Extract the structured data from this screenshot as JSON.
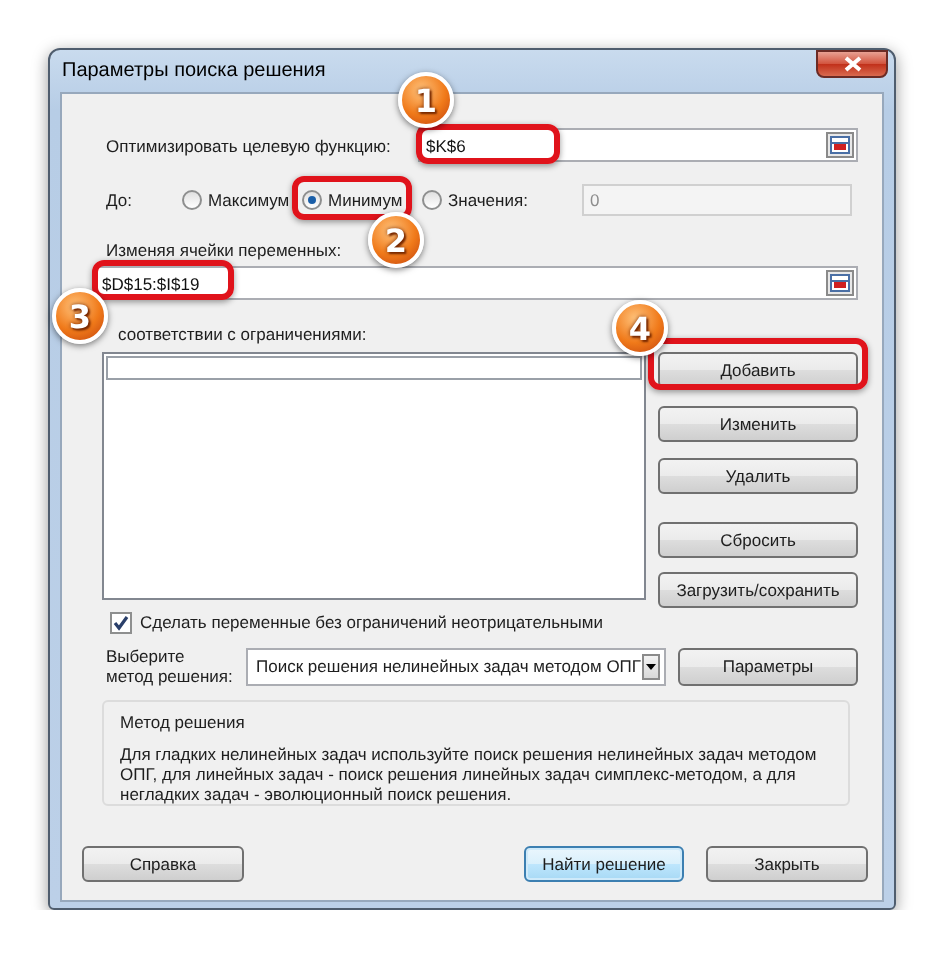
{
  "window": {
    "title": "Параметры поиска решения"
  },
  "objective": {
    "label": "Оптимизировать целевую функцию:",
    "value": "$K$6"
  },
  "to": {
    "label": "До:",
    "options": [
      {
        "label": "Максимум",
        "selected": false
      },
      {
        "label": "Минимум",
        "selected": true
      },
      {
        "label": "Значения:",
        "selected": false
      }
    ],
    "value_field": {
      "value": "0",
      "disabled": true
    }
  },
  "variables": {
    "label": "Изменяя ячейки переменных:",
    "value": "$D$15:$I$19"
  },
  "constraints": {
    "label": "соответствии с ограничениями:",
    "buttons": [
      "Добавить",
      "Изменить",
      "Удалить",
      "Сбросить",
      "Загрузить/сохранить"
    ]
  },
  "nonnegative": {
    "label": "Сделать переменные без ограничений неотрицательными",
    "checked": true
  },
  "method": {
    "label_lines": [
      "Выберите",
      "метод решения:"
    ],
    "value": "Поиск решения нелинейных задач методом ОПГ",
    "options_button": "Параметры"
  },
  "method_info": {
    "title": "Метод решения",
    "text": "Для гладких нелинейных задач используйте поиск решения нелинейных задач методом ОПГ, для линейных задач - поиск решения линейных задач симплекс-методом, а для негладких задач - эволюционный поиск решения."
  },
  "footer_buttons": [
    {
      "label": "Справка",
      "default": false
    },
    {
      "label": "Найти решение",
      "default": true
    },
    {
      "label": "Закрыть",
      "default": false
    }
  ],
  "annotations": [
    {
      "number": "1"
    },
    {
      "number": "2"
    },
    {
      "number": "3"
    },
    {
      "number": "4"
    }
  ]
}
